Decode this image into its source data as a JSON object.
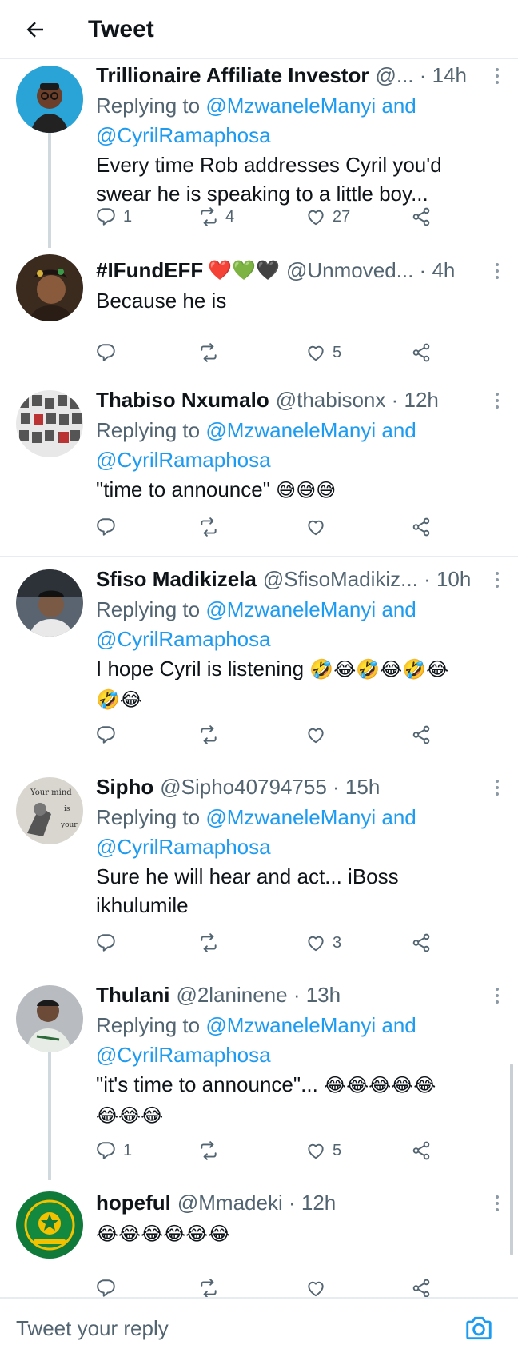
{
  "header": {
    "title": "Tweet",
    "back_icon": "arrow-left-icon"
  },
  "replying_prefix": "Replying to",
  "and_word": "and",
  "tweets": [
    {
      "name": "Trillionaire Affiliate Investor",
      "handle": "@...",
      "time": "14h",
      "replying": [
        "@MzwaneleManyi",
        "@CyrilRamaphosa"
      ],
      "text": "Every time Rob addresses Cyril you'd swear he is speaking to a little boy...",
      "replies": "1",
      "retweets": "4",
      "likes": "27",
      "avatar_color": "#2aa3d6"
    },
    {
      "name": "#IFundEFF",
      "name_emoji": "❤️💚🖤",
      "handle": "@Unmoved...",
      "time": "4h",
      "text": "Because he is",
      "replies": "",
      "retweets": "",
      "likes": "5",
      "avatar_color": "#3b2a1e"
    },
    {
      "name": "Thabiso Nxumalo",
      "handle": "@thabisonx",
      "time": "12h",
      "replying": [
        "@MzwaneleManyi",
        "@CyrilRamaphosa"
      ],
      "text": "\"time to announce\"",
      "text_emoji": "😅😅😅",
      "replies": "",
      "retweets": "",
      "likes": "",
      "avatar_color": "#6b6b6b"
    },
    {
      "name": "Sfiso Madikizela",
      "handle": "@SfisoMadikiz...",
      "time": "10h",
      "replying": [
        "@MzwaneleManyi",
        "@CyrilRamaphosa"
      ],
      "text": "I hope Cyril is listening",
      "text_emoji": "🤣😂🤣😂🤣😂",
      "text_emoji2": "🤣😂",
      "replies": "",
      "retweets": "",
      "likes": "",
      "avatar_color": "#7a5a45"
    },
    {
      "name": "Sipho",
      "handle": "@Sipho40794755",
      "time": "15h",
      "replying": [
        "@MzwaneleManyi",
        "@CyrilRamaphosa"
      ],
      "text": "Sure he will hear and act... iBoss ikhulumile",
      "avatar_text_1": "Your mind",
      "avatar_text_2": "is",
      "avatar_text_3": "your",
      "replies": "",
      "retweets": "",
      "likes": "3",
      "avatar_color": "#d9d6cf"
    },
    {
      "name": "Thulani",
      "handle": "@2laninene",
      "time": "13h",
      "replying": [
        "@MzwaneleManyi",
        "@CyrilRamaphosa"
      ],
      "text": "\"it's time to announce\"...",
      "text_emoji": "😂😂😂😂😂",
      "text_emoji2": "😂😂😂",
      "replies": "1",
      "retweets": "",
      "likes": "5",
      "avatar_color": "#8c8f93"
    },
    {
      "name": "hopeful",
      "handle": "@Mmadeki",
      "time": "12h",
      "text_emoji": "😂😂😂😂😂😂",
      "replies": "",
      "retweets": "",
      "likes": "",
      "avatar_color": "#0f7a3a"
    }
  ],
  "reply_bar": {
    "placeholder": "Tweet your reply",
    "camera_icon": "camera-icon"
  },
  "colors": {
    "accent": "#1d9bf0",
    "secondary_text": "#536471",
    "border": "#e6ecf0"
  }
}
